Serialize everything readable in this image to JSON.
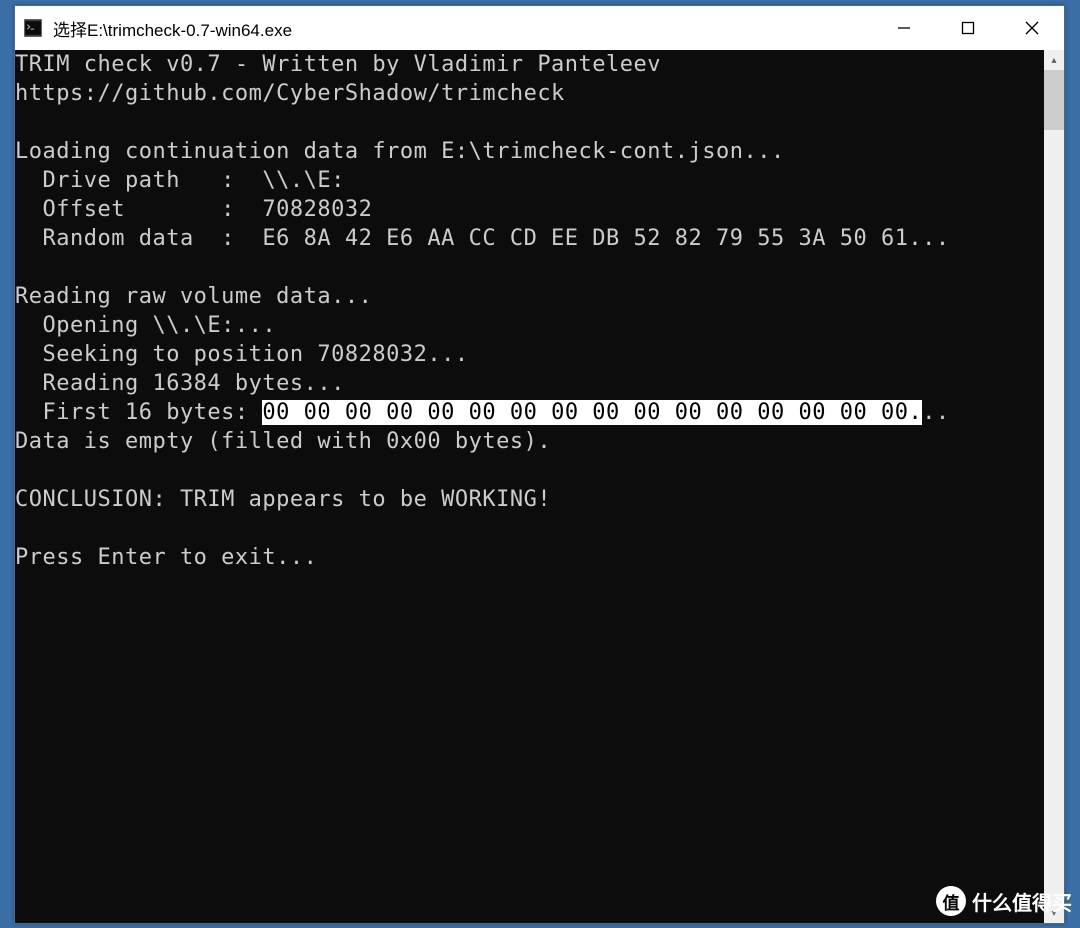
{
  "window": {
    "title": "选择E:\\trimcheck-0.7-win64.exe"
  },
  "console": {
    "line1": "TRIM check v0.7 - Written by Vladimir Panteleev",
    "line2": "https://github.com/CyberShadow/trimcheck",
    "blank1": "",
    "line3": "Loading continuation data from E:\\trimcheck-cont.json...",
    "line4": "  Drive path   :  \\\\.\\E:",
    "line5": "  Offset       :  70828032",
    "line6": "  Random data  :  E6 8A 42 E6 AA CC CD EE DB 52 82 79 55 3A 50 61...",
    "blank2": "",
    "line7": "Reading raw volume data...",
    "line8": "  Opening \\\\.\\E:...",
    "line9": "  Seeking to position 70828032...",
    "line10": "  Reading 16384 bytes...",
    "line11_prefix": "  First 16 bytes: ",
    "line11_highlight": "00 00 00 00 00 00 00 00 00 00 00 00 00 00 00 00.",
    "line11_suffix": "..",
    "line12": "Data is empty (filled with 0x00 bytes).",
    "blank3": "",
    "line13": "CONCLUSION: TRIM appears to be WORKING!",
    "blank4": "",
    "line14": "Press Enter to exit..."
  },
  "watermark": {
    "badge": "值",
    "text": "什么值得买"
  }
}
